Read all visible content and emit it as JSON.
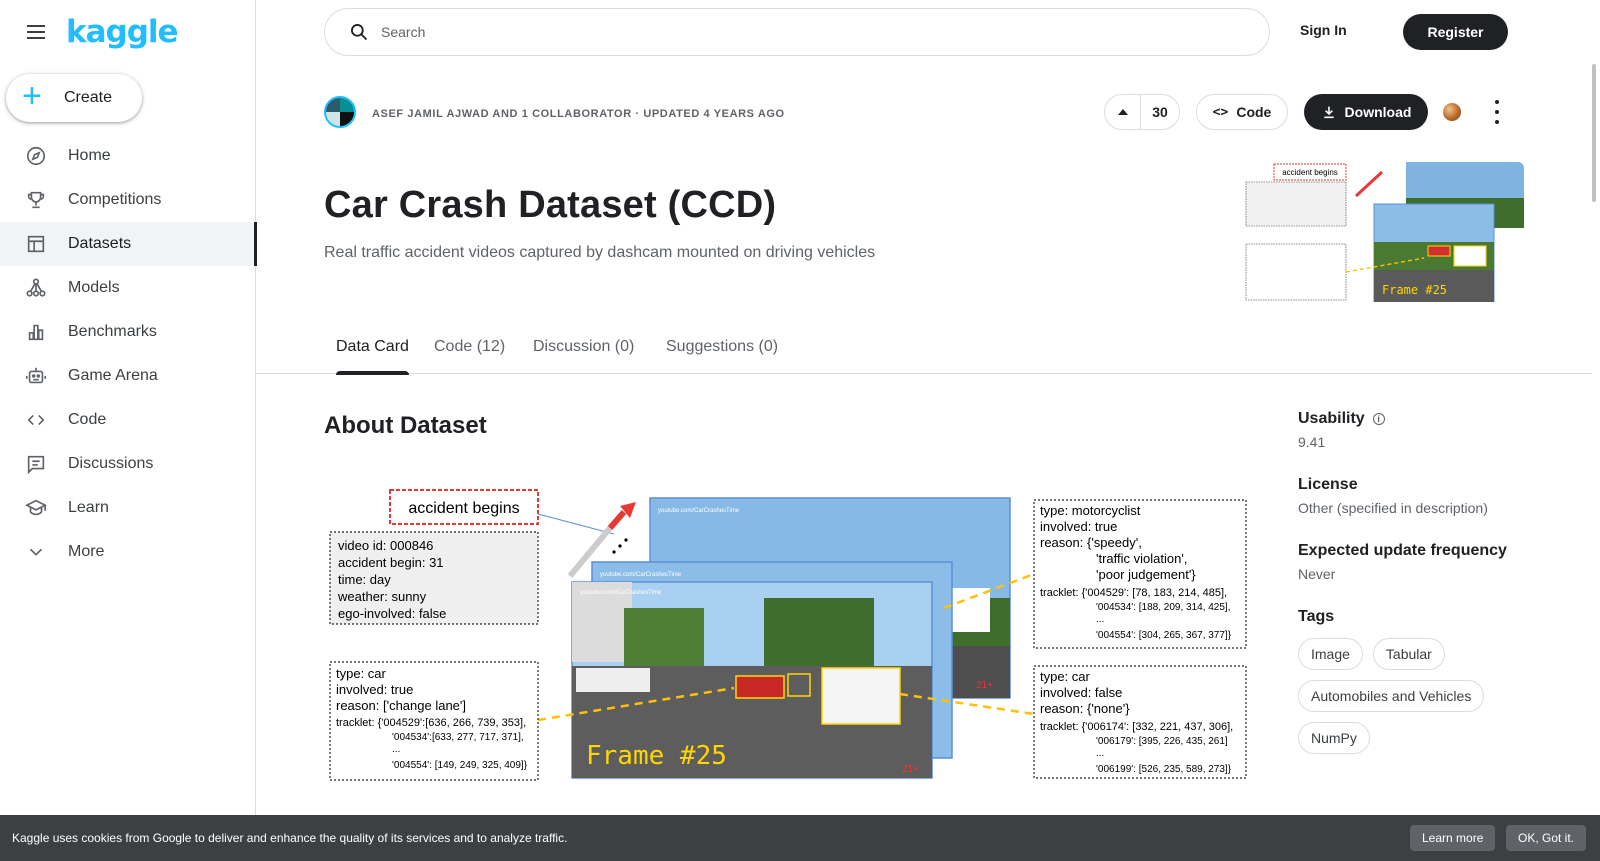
{
  "brand": {
    "logo": "kaggle",
    "accent": "#20beff"
  },
  "sidebar": {
    "create_label": "Create",
    "items": [
      {
        "label": "Home",
        "icon": "compass-icon"
      },
      {
        "label": "Competitions",
        "icon": "trophy-icon"
      },
      {
        "label": "Datasets",
        "icon": "table-icon",
        "active": true
      },
      {
        "label": "Models",
        "icon": "models-icon"
      },
      {
        "label": "Benchmarks",
        "icon": "bar-chart-icon"
      },
      {
        "label": "Game Arena",
        "icon": "robot-icon"
      },
      {
        "label": "Code",
        "icon": "code-icon"
      },
      {
        "label": "Discussions",
        "icon": "comment-icon"
      },
      {
        "label": "Learn",
        "icon": "school-icon"
      },
      {
        "label": "More",
        "icon": "chevron-down-icon"
      }
    ]
  },
  "topbar": {
    "search_placeholder": "Search",
    "signin_label": "Sign In",
    "register_label": "Register"
  },
  "dataset": {
    "byline": "Asef Jamil Ajwad and 1 collaborator · Updated 4 years ago",
    "votes": "30",
    "code_label": "Code",
    "download_label": "Download",
    "title": "Car Crash Dataset (CCD)",
    "subtitle": "Real traffic accident videos captured by dashcam mounted on driving vehicles"
  },
  "tabs": [
    {
      "label": "Data Card",
      "active": true
    },
    {
      "label": "Code (12)"
    },
    {
      "label": "Discussion (0)"
    },
    {
      "label": "Suggestions (0)"
    }
  ],
  "about_heading": "About Dataset",
  "figure": {
    "accident_label": "accident begins",
    "meta_box": [
      "video id: 000846",
      "accident begin: 31",
      "time: day",
      "weather: sunny",
      "ego-involved: false"
    ],
    "car_box": [
      "type: car",
      "involved: true",
      "reason: ['change lane']",
      "tracklet: {'004529':[636, 266, 739, 353],",
      "'004534':[633, 277, 717, 371],",
      "...",
      "'004554': [149, 249, 325, 409]}"
    ],
    "moto_box": [
      "type: motorcyclist",
      "involved: true",
      "reason: {'speedy',",
      "'traffic violation',",
      "'poor judgement'}",
      "tracklet: {'004529': [78, 183, 214, 485],",
      "'004534': [188, 209, 314, 425],",
      "...",
      "'004554': [304, 265, 367, 377]}"
    ],
    "car2_box": [
      "type: car",
      "involved: false",
      "reason: {'none'}",
      "tracklet: {'006174': [332, 221, 437, 306],",
      "'006179': [395, 226, 435, 261]",
      "...",
      "'006199': [526, 235, 589, 273]}"
    ],
    "frame_label": "Frame #25",
    "watermark": "youtube.com/CarCrashesTime",
    "age_badge": "21+"
  },
  "meta": {
    "usability_label": "Usability",
    "usability_value": "9.41",
    "license_label": "License",
    "license_value": "Other (specified in description)",
    "frequency_label": "Expected update frequency",
    "frequency_value": "Never",
    "tags_label": "Tags",
    "tags": [
      "Image",
      "Tabular",
      "Automobiles and Vehicles",
      "NumPy"
    ]
  },
  "cookie": {
    "text": "Kaggle uses cookies from Google to deliver and enhance the quality of its services and to analyze traffic.",
    "learn_more": "Learn more",
    "ok": "OK, Got it."
  }
}
